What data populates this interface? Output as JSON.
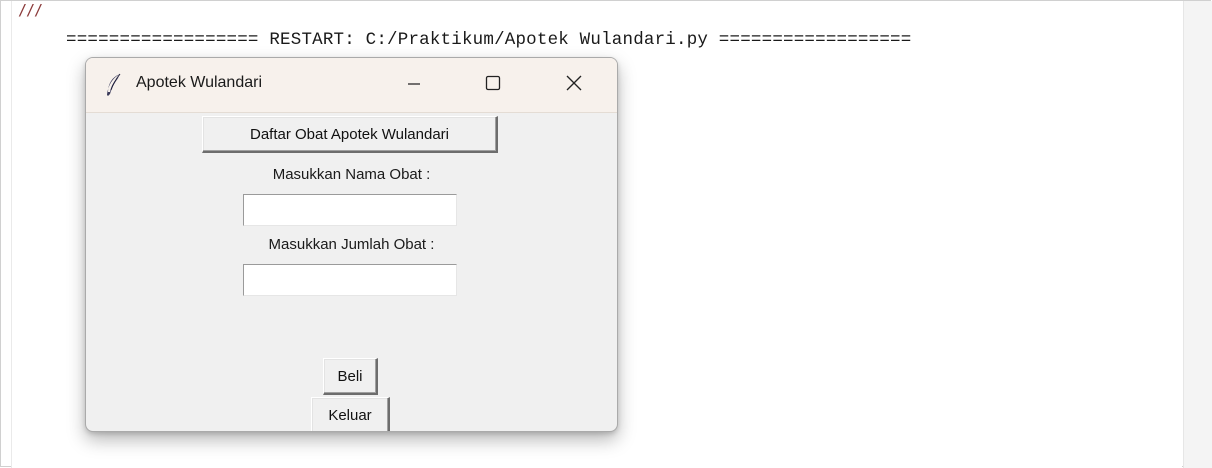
{
  "shell": {
    "prompt_marks": "///",
    "restart_line": "================== RESTART: C:/Praktikum/Apotek Wulandari.py =================="
  },
  "window": {
    "title": "Apotek Wulandari",
    "icon": "feather-icon",
    "controls": {
      "minimize": "minimize-icon",
      "maximize": "maximize-icon",
      "close": "close-icon"
    }
  },
  "form": {
    "daftar_button_label": "Daftar Obat Apotek Wulandari",
    "nama_label": "Masukkan Nama Obat :",
    "nama_value": "",
    "jumlah_label": "Masukkan Jumlah Obat :",
    "jumlah_value": "",
    "beli_button_label": "Beli",
    "keluar_button_label": "Keluar"
  },
  "colors": {
    "titlebar": "#f7f1ec",
    "window_bg": "#f0f0f0",
    "prompt": "#8b3a3a"
  }
}
